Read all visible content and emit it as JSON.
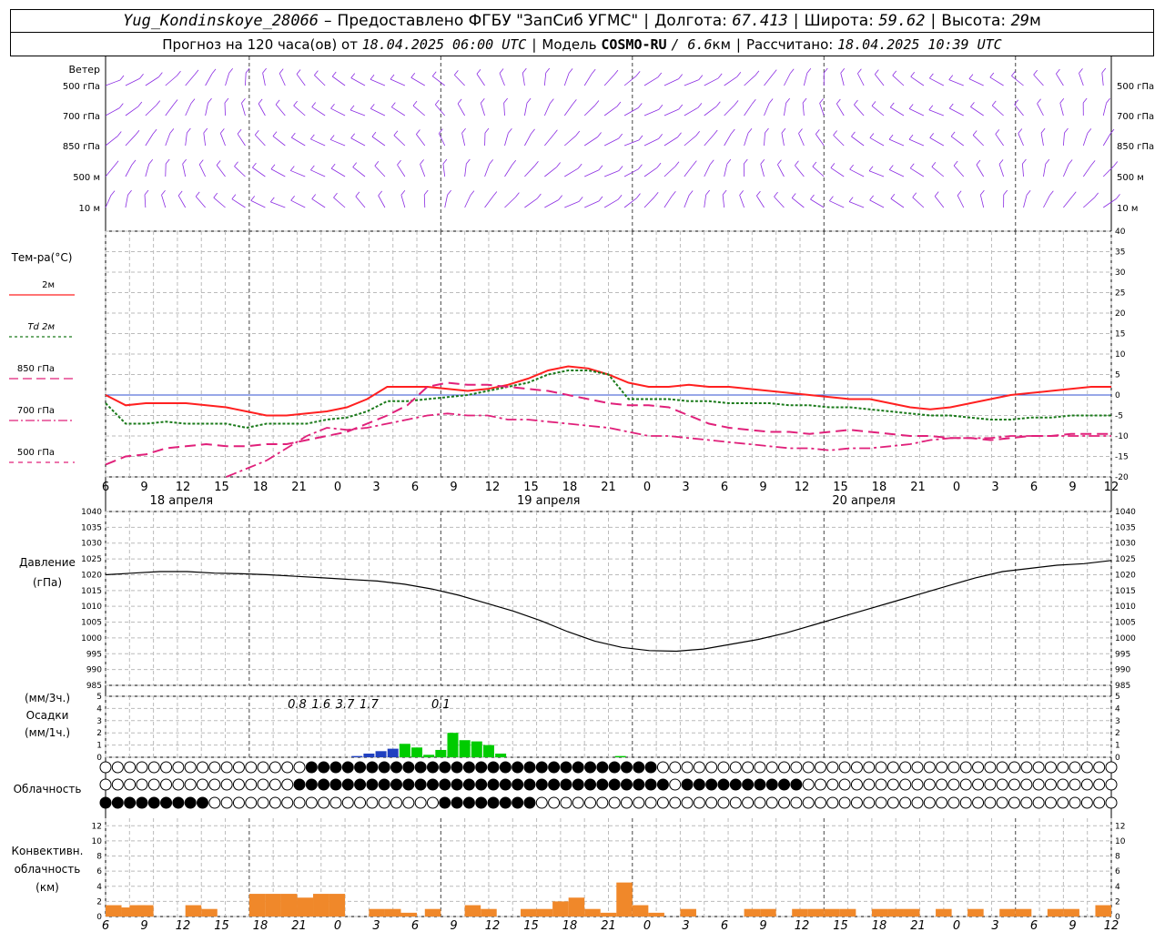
{
  "header": {
    "station": "Yug_Kondinskoye_28066",
    "dash": "–",
    "provider": "Предоставлено ФГБУ \"ЗапСиб УГМС\"",
    "lon_label": "Долгота:",
    "lon_value": "67.413",
    "lat_label": "Широта:",
    "lat_value": "59.62",
    "alt_label": "Высота:",
    "alt_value": "29",
    "alt_unit": "м",
    "forecast_prefix": "Прогноз на 120 часа(ов) от",
    "forecast_time": "18.04.2025 06:00 UTC",
    "model_label": "Модель",
    "model_name": "COSMO-RU",
    "model_res": "/ 6.6",
    "model_res_unit": "км",
    "calc_label": "Рассчитано:",
    "calc_time": "18.04.2025 10:39 UTC"
  },
  "labels": {
    "wind_title": "Ветер",
    "wind_levels": [
      "500 гПа",
      "700 гПа",
      "850 гПа",
      "500  м",
      "10  м"
    ],
    "temp_title": "Тем-ра(°C)",
    "temp_legend": [
      {
        "text": "2м",
        "color": "#ff2020",
        "dash": ""
      },
      {
        "text": "Td  2м",
        "color": "#1a7a1a",
        "dash": "3,3"
      },
      {
        "text": "850 гПа",
        "color": "#e0207a",
        "dash": "10,5"
      },
      {
        "text": "700 гПа",
        "color": "#e0207a",
        "dash": "10,3,2,3"
      },
      {
        "text": "500 гПа",
        "color": "#e0207a",
        "dash": "5,5"
      }
    ],
    "pressure_title": "Давление",
    "pressure_unit": "(гПа)",
    "precip_unit3": "(мм/3ч.)",
    "precip_title": "Осадки",
    "precip_unit1": "(мм/1ч.)",
    "cloud_title": "Облачность",
    "conv_title1": "Конвективн.",
    "conv_title2": "облачность",
    "conv_unit": "(км)",
    "day_labels": [
      "18 апреля",
      "19 апреля",
      "20 апреля"
    ]
  },
  "colors": {
    "temp2m": "#ff2020",
    "td2m": "#1a7a1a",
    "upper": "#e0207a",
    "wind": "#8a2be2",
    "precip_green": "#00cc00",
    "precip_blue": "#2040c0",
    "conv": "#f0882a",
    "grid": "#999999"
  },
  "chart_data": [
    {
      "type": "line",
      "title": "Тем-ра(°C)",
      "x_hours_ticks": [
        "6",
        "9",
        "12",
        "15",
        "18",
        "21",
        "0",
        "3",
        "6",
        "9",
        "12",
        "15",
        "18",
        "21",
        "0",
        "3",
        "6",
        "9",
        "12",
        "15",
        "18",
        "21",
        "0",
        "3",
        "6",
        "9",
        "12"
      ],
      "ylim": [
        -20,
        40
      ],
      "yticks": [
        40,
        35,
        30,
        25,
        20,
        15,
        10,
        5,
        0,
        -5,
        -10,
        -15,
        -20
      ],
      "series": [
        {
          "name": "2м",
          "values": [
            0,
            -2.5,
            -2,
            -2,
            -2,
            -2.5,
            -3,
            -4,
            -5,
            -5,
            -4.5,
            -4,
            -3,
            -1,
            2,
            2,
            2,
            1.5,
            1,
            1.5,
            2.5,
            4,
            6,
            7,
            6.5,
            5,
            3,
            2,
            2,
            2.5,
            2,
            2,
            1.5,
            1,
            0.5,
            0,
            -0.5,
            -1,
            -1,
            -2,
            -3,
            -3.5,
            -3,
            -2,
            -1,
            0,
            0.5,
            1,
            1.5,
            2,
            2
          ]
        },
        {
          "name": "Td 2м",
          "values": [
            -2,
            -7,
            -7,
            -6.5,
            -7,
            -7,
            -7,
            -8,
            -7,
            -7,
            -7,
            -6,
            -5.5,
            -4,
            -1.5,
            -1.5,
            -1,
            -0.5,
            0,
            1,
            2,
            3,
            5,
            6,
            6,
            5,
            -1,
            -1,
            -1,
            -1.5,
            -1.5,
            -2,
            -2,
            -2,
            -2.5,
            -2.5,
            -3,
            -3,
            -3.5,
            -4,
            -4.5,
            -5,
            -5,
            -5.5,
            -6,
            -6,
            -5.5,
            -5.5,
            -5,
            -5,
            -5
          ]
        },
        {
          "name": "850 гПа",
          "values": [
            -17,
            -15,
            -14.5,
            -13,
            -12.5,
            -12,
            -12.5,
            -12.5,
            -12,
            -12,
            -11,
            -10,
            -9,
            -7,
            -5,
            -2.5,
            2,
            3,
            2.5,
            2.5,
            2,
            1.5,
            1,
            0,
            -1,
            -2,
            -2.5,
            -2.5,
            -3,
            -5,
            -7,
            -8,
            -8.5,
            -9,
            -9,
            -9.5,
            -9,
            -8.5,
            -9,
            -9.5,
            -10,
            -10,
            -10.5,
            -10.5,
            -11,
            -10.5,
            -10,
            -10,
            -9.5,
            -9.5,
            -9.5
          ]
        },
        {
          "name": "700 гПа",
          "values": [
            null,
            null,
            null,
            null,
            null,
            null,
            -20,
            -18,
            -16,
            -13,
            -10,
            -8,
            -8.5,
            -8,
            -7,
            -6,
            -5,
            -4.5,
            -5,
            -5,
            -6,
            -6,
            -6.5,
            -7,
            -7.5,
            -8,
            -9,
            -10,
            -10,
            -10.5,
            -11,
            -11.5,
            -12,
            -12.5,
            -13,
            -13,
            -13.5,
            -13,
            -13,
            -12.5,
            -12,
            -11,
            -10.5,
            -10.5,
            -10.5,
            -10,
            -10,
            -10,
            -10,
            -10,
            -10
          ]
        }
      ]
    },
    {
      "type": "line",
      "title": "Давление",
      "ylim": [
        985,
        1040
      ],
      "yticks": [
        1040,
        1035,
        1030,
        1025,
        1020,
        1015,
        1010,
        1005,
        1000,
        995,
        990,
        985
      ],
      "series": [
        {
          "name": "Давление",
          "values": [
            1020,
            1020.5,
            1021,
            1021,
            1020.5,
            1020.3,
            1020,
            1019.5,
            1019,
            1018.5,
            1018,
            1017,
            1015.5,
            1013.5,
            1011,
            1008.5,
            1005.5,
            1002,
            999,
            997,
            996,
            995.8,
            996.5,
            998,
            999.5,
            1001.5,
            1004,
            1006.5,
            1009,
            1011.5,
            1014,
            1016.5,
            1019,
            1021,
            1022,
            1023,
            1023.5,
            1024.5
          ]
        }
      ]
    },
    {
      "type": "bar",
      "title": "Осадки",
      "ylim": [
        0,
        5
      ],
      "labels_3h": [
        "0.8",
        "1.6",
        "3.7",
        "1.7",
        "0.1"
      ],
      "labels_3h_hours": [
        24,
        27,
        30,
        33,
        42
      ]
    },
    {
      "type": "bar",
      "title": "Конвективн. облачность",
      "ylim": [
        0,
        13
      ],
      "yticks": [
        12,
        10,
        8,
        6,
        4,
        2,
        0
      ]
    }
  ]
}
